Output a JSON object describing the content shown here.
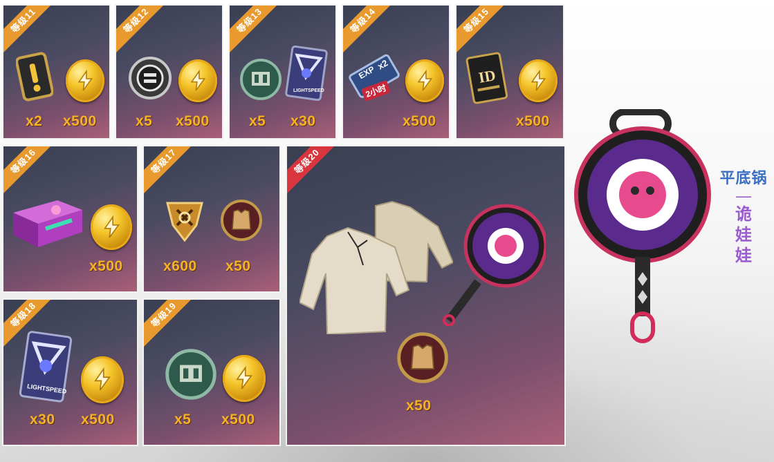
{
  "title": {
    "line1": "平底锅",
    "divider": "—",
    "line2_chars": [
      "诡",
      "娃",
      "娃"
    ]
  },
  "levels": {
    "l11": {
      "label": "等级11",
      "qty1": "x2",
      "qty2": "x500"
    },
    "l12": {
      "label": "等级12",
      "qty1": "x5",
      "qty2": "x500"
    },
    "l13": {
      "label": "等级13",
      "qty1": "x5",
      "qty2": "x30",
      "card_text": "LIGHTSPEED"
    },
    "l14": {
      "label": "等级14",
      "qty2": "x500",
      "exp_text": "EXP",
      "mult": "x2",
      "time": "2小时"
    },
    "l15": {
      "label": "等级15",
      "qty2": "x500",
      "card_text": "ID"
    },
    "l16": {
      "label": "等级16",
      "qty2": "x500"
    },
    "l17": {
      "label": "等级17",
      "qty1": "x600",
      "qty2": "x50"
    },
    "l18": {
      "label": "等级18",
      "qty1": "x30",
      "qty2": "x500",
      "card_text": "LIGHTSPEED"
    },
    "l19": {
      "label": "等级19",
      "qty1": "x5",
      "qty2": "x500"
    },
    "l20": {
      "label": "等级20",
      "qty": "x50"
    }
  },
  "colors": {
    "ribbon_orange": "#e89a2e",
    "ribbon_red": "#d8353e",
    "qty_gold": "#f5b227",
    "title_blue": "#3a6fc2",
    "title_purple": "#9a5bd0"
  }
}
